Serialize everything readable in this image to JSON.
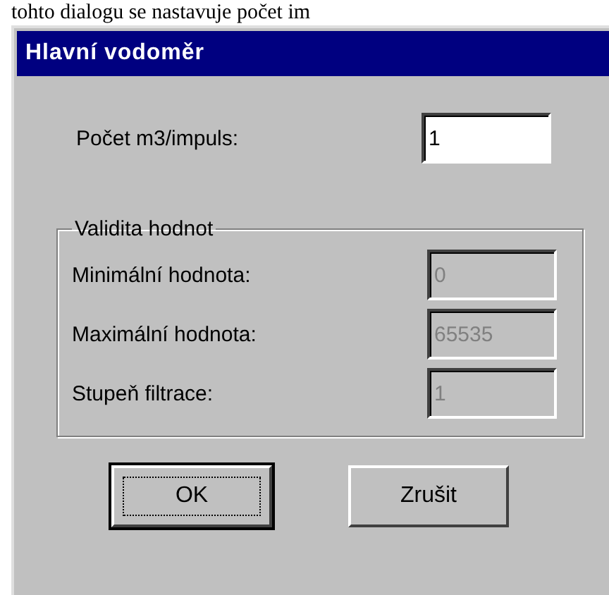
{
  "page_text": "tohto dialogu se nastavuje počet im",
  "window": {
    "title": "Hlavní vodoměr"
  },
  "impulse_field": {
    "label": "Počet  m3/impuls:",
    "value": "1",
    "disabled": false
  },
  "validity_group": {
    "title": "Validita hodnot",
    "fields": [
      {
        "label": "Minimální hodnota:",
        "value": "0",
        "disabled": true
      },
      {
        "label": "Maximální hodnota:",
        "value": "65535",
        "disabled": true
      },
      {
        "label": "Stupeň filtrace:",
        "value": "1",
        "disabled": true
      }
    ]
  },
  "buttons": [
    {
      "label": "OK",
      "default": true
    },
    {
      "label": "Zrušit",
      "default": false
    }
  ]
}
